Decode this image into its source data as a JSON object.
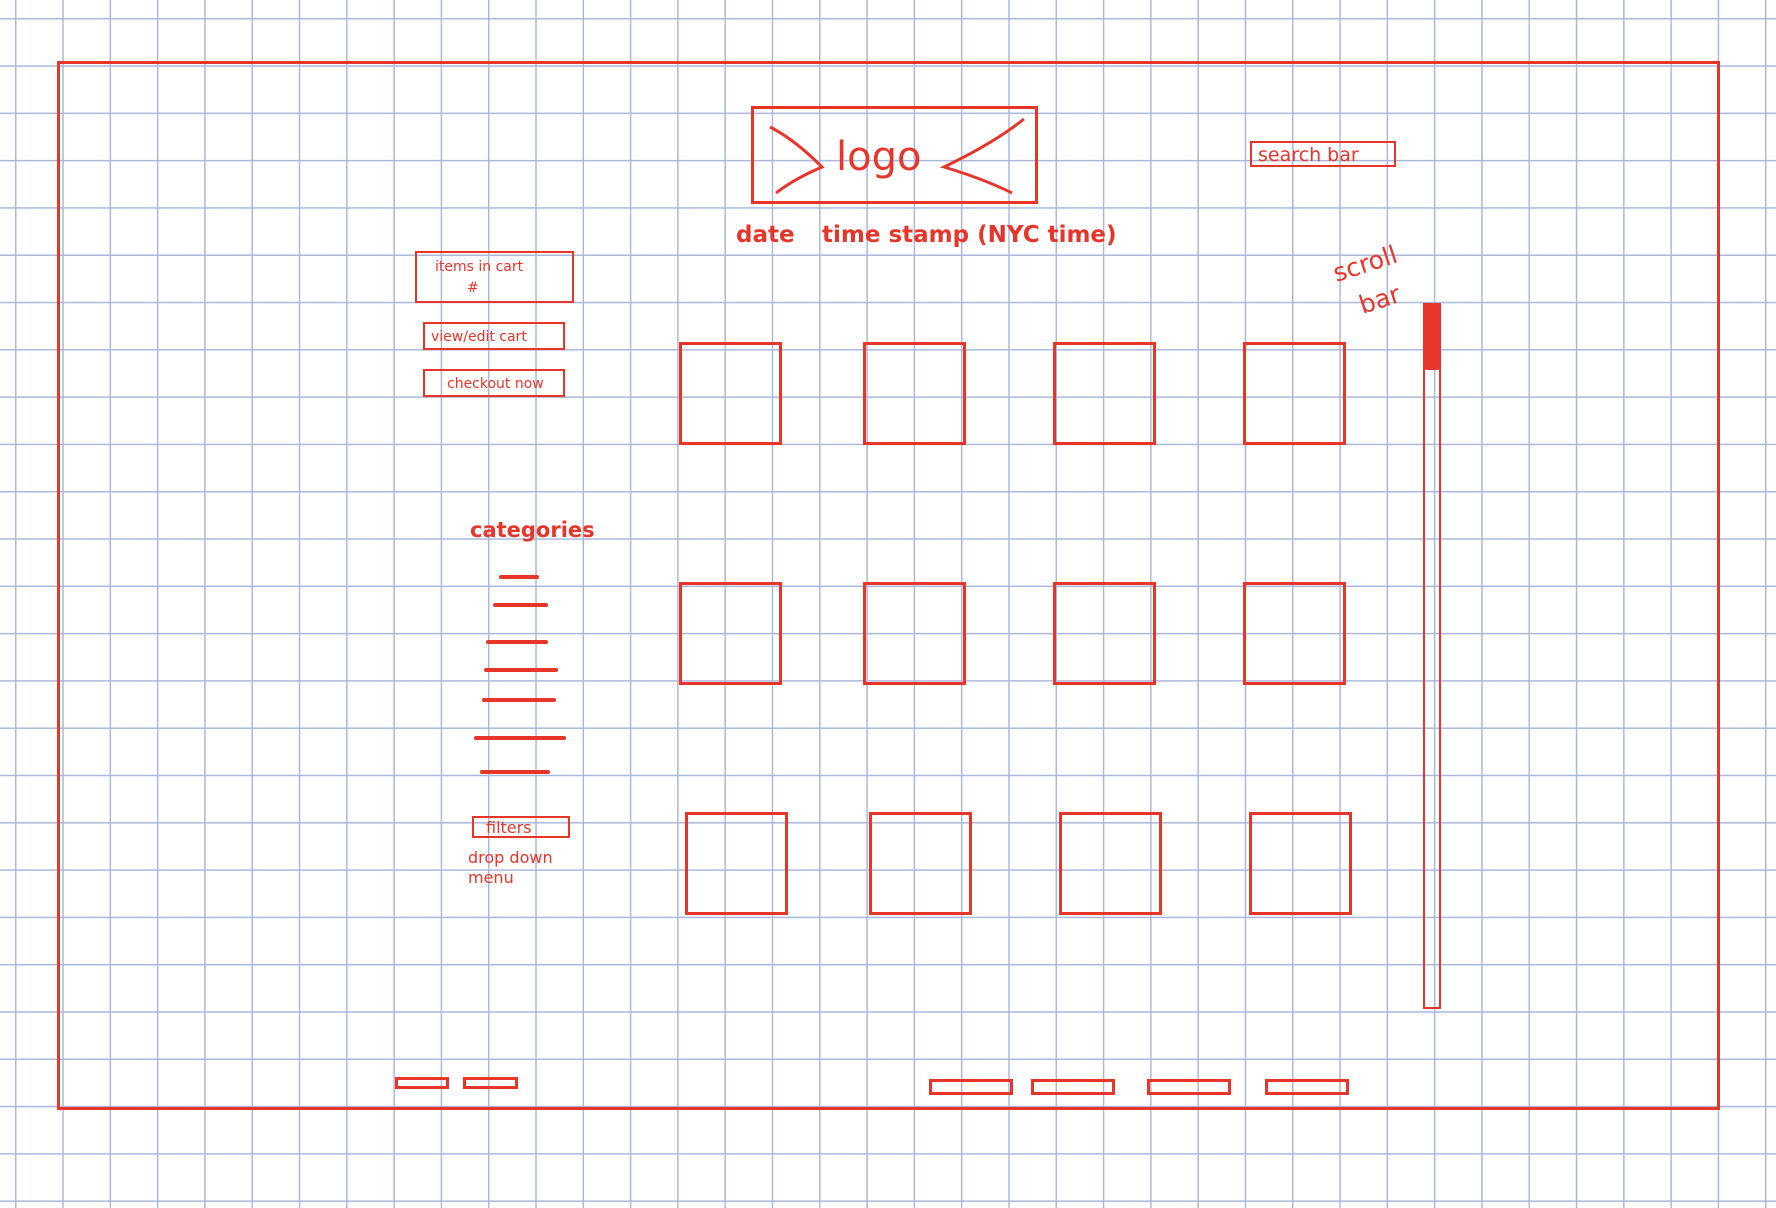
{
  "header": {
    "logo_label": "logo",
    "date_label": "date",
    "timestamp_label": "time stamp (NYC time)",
    "search_label": "search bar"
  },
  "cart": {
    "items_label": "items in cart",
    "items_count": "#",
    "view_edit_label": "view/edit cart",
    "checkout_label": "checkout now"
  },
  "categories": {
    "title": "categories"
  },
  "filters": {
    "button_label": "filters",
    "note": "drop down menu"
  },
  "scrollbar": {
    "label_line1": "scroll",
    "label_line2": "bar",
    "position": 0
  },
  "product_grid": {
    "rows": 3,
    "columns": 4
  },
  "colors": {
    "ink": "#e8352a",
    "grid": "#a9b9dc"
  }
}
